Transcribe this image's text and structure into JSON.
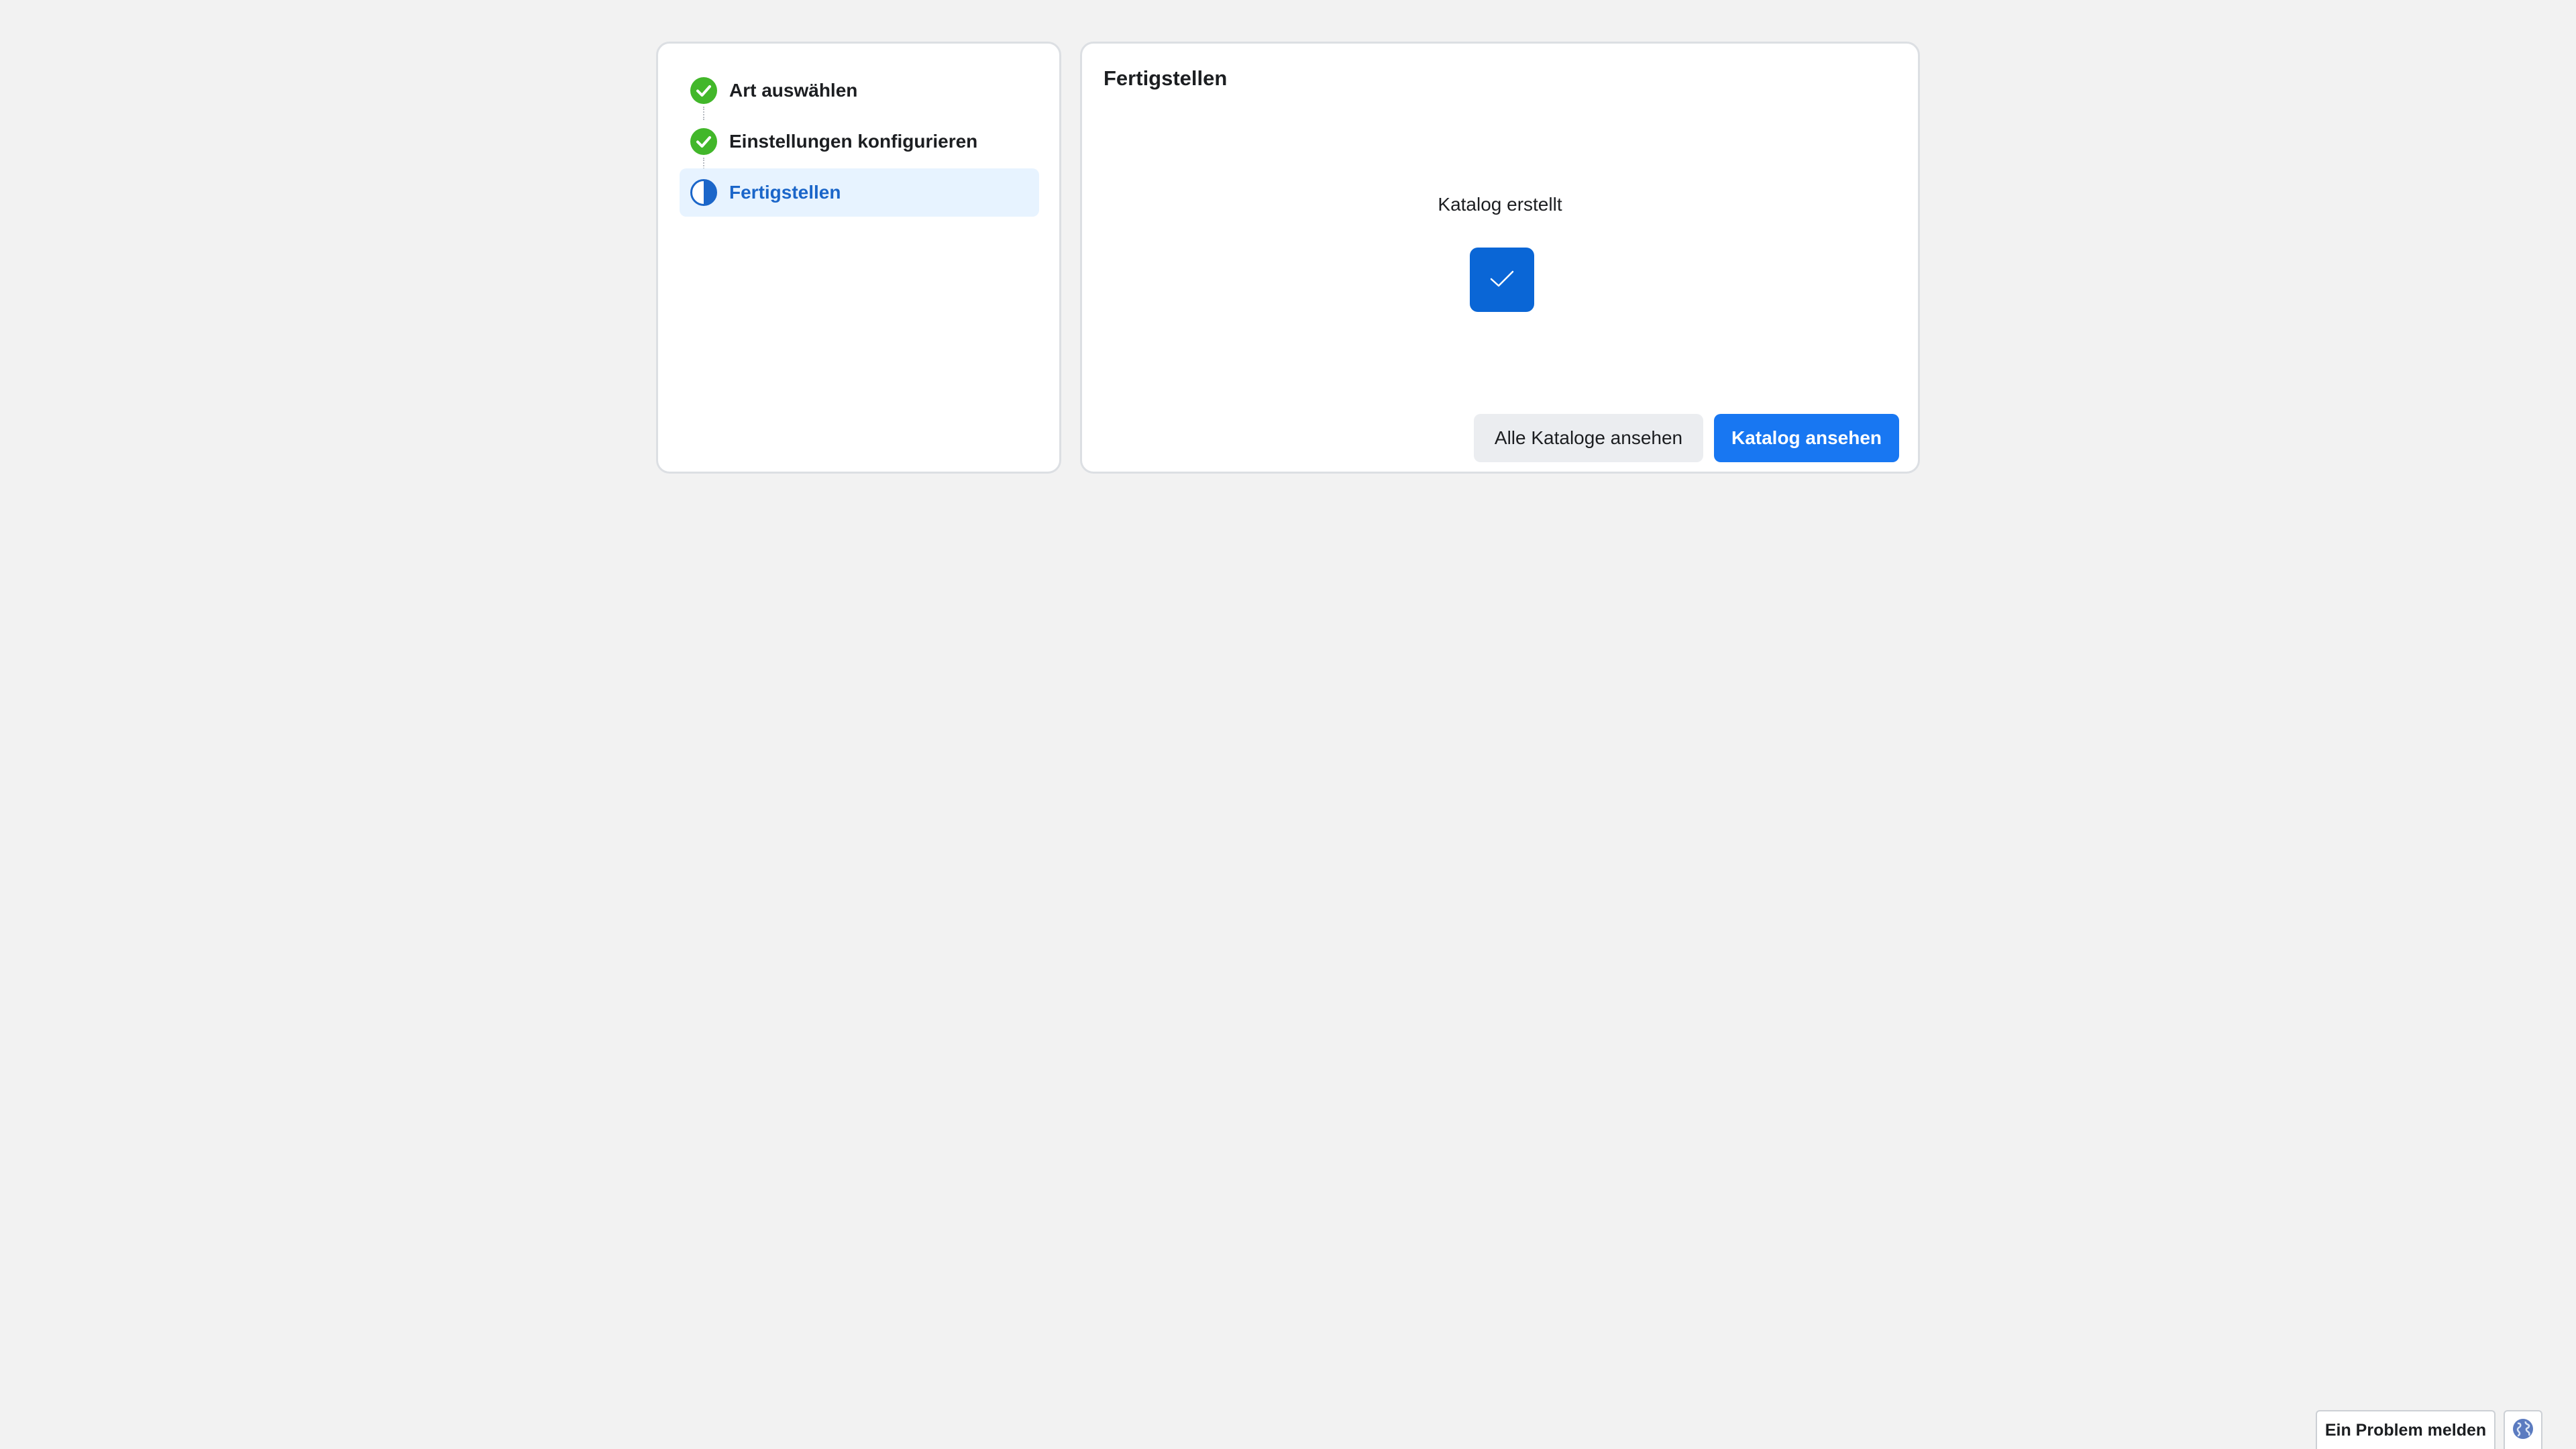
{
  "stepper": {
    "steps": [
      {
        "label": "Art auswählen",
        "state": "completed",
        "icon": "check-circle-icon"
      },
      {
        "label": "Einstellungen konfigurieren",
        "state": "completed",
        "icon": "check-circle-icon"
      },
      {
        "label": "Fertigstellen",
        "state": "current",
        "icon": "half-circle-icon"
      }
    ]
  },
  "main": {
    "title": "Fertigstellen",
    "status_text": "Katalog erstellt",
    "status_icon": "checkmark-icon",
    "secondary_button_label": "Alle Kataloge ansehen",
    "primary_button_label": "Katalog ansehen"
  },
  "footer": {
    "report_label": "Ein Problem melden",
    "language_icon": "globe-icon"
  },
  "colors": {
    "background": "#f2f2f2",
    "completed": "#42b72a",
    "current": "#1b66c9",
    "current_bg": "#e7f3ff",
    "primary": "#1877f2",
    "tile": "#0a66d6"
  }
}
